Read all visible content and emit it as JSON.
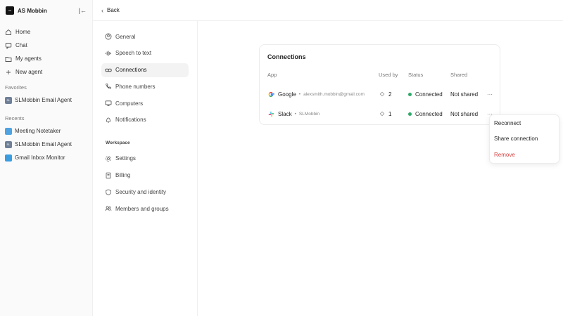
{
  "sidebar": {
    "workspace_initials": "AS",
    "workspace_name": "AS Mobbin",
    "nav": [
      {
        "label": "Home"
      },
      {
        "label": "Chat"
      },
      {
        "label": "My agents"
      },
      {
        "label": "New agent"
      }
    ],
    "favorites_label": "Favorites",
    "favorites": [
      {
        "label": "SLMobbin Email Agent",
        "badge": "#6f7f97",
        "initials": "SL"
      }
    ],
    "recents_label": "Recents",
    "recents": [
      {
        "label": "Meeting Notetaker",
        "badge": "#4fa3e0",
        "initials": ""
      },
      {
        "label": "SLMobbin Email Agent",
        "badge": "#6f7f97",
        "initials": "SL"
      },
      {
        "label": "Gmail Inbox Monitor",
        "badge": "#3b9ddf",
        "initials": ""
      }
    ]
  },
  "topbar": {
    "back_label": "Back"
  },
  "settings": {
    "items": [
      {
        "label": "General"
      },
      {
        "label": "Speech to text"
      },
      {
        "label": "Connections"
      },
      {
        "label": "Phone numbers"
      },
      {
        "label": "Computers"
      },
      {
        "label": "Notifications"
      }
    ],
    "workspace_label": "Workspace",
    "workspace_items": [
      {
        "label": "Settings"
      },
      {
        "label": "Billing"
      },
      {
        "label": "Security and identity"
      },
      {
        "label": "Members and groups"
      }
    ]
  },
  "connections": {
    "title": "Connections",
    "headers": {
      "app": "App",
      "used_by": "Used by",
      "status": "Status",
      "shared": "Shared"
    },
    "rows": [
      {
        "app": "Google",
        "account": "alexsmith.mobbin@gmail.com",
        "used_by": "2",
        "status": "Connected",
        "shared": "Not shared"
      },
      {
        "app": "Slack",
        "account": "SLMobbin",
        "used_by": "1",
        "status": "Connected",
        "shared": "Not shared"
      }
    ],
    "more_symbol": "···"
  },
  "context_menu": {
    "reconnect": "Reconnect",
    "share": "Share connection",
    "remove": "Remove"
  },
  "colors": {
    "connected": "#2fa869",
    "danger": "#d64545"
  }
}
